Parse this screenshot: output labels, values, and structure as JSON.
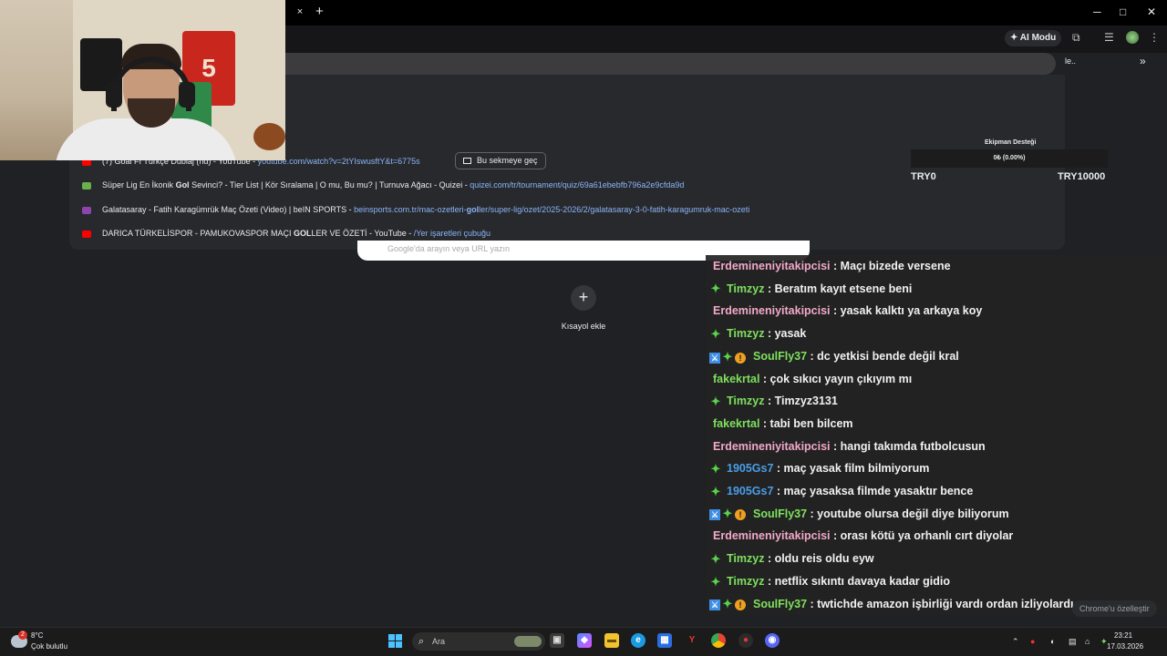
{
  "browser": {
    "tab_close": "×",
    "new_tab": "+",
    "win_min": "─",
    "win_max": "□",
    "win_close": "✕",
    "ai_mode_label": "AI Modu",
    "bookmark_text": "le..",
    "bookmark_more": "»"
  },
  "suggestions": [
    {
      "title": "(7) Goal Fı Türkçe Dublaj (hd) - YouTube",
      "sep": " - ",
      "url_pre": "youtube.com/watch?v=2tYIswusftY&t=6775s",
      "color": "#ff0000"
    },
    {
      "title_pre": "Süper Lig En İkonik ",
      "title_bold": "Gol",
      "title_post": " Sevinci? - Tier List | Kör Sıralama | O mu, Bu mu? | Turnuva Ağacı - Quizei",
      "sep": " - ",
      "url": "quizei.com/tr/tournament/quiz/69a61ebebfb796a2e9cfda9d",
      "color": "#6ab04c"
    },
    {
      "title": "Galatasaray - Fatih Karagümrük Maç Özeti (Video) | beIN SPORTS",
      "sep": " - ",
      "url_pre": "beinsports.com.tr/mac-ozetleri-",
      "url_bold": "gol",
      "url_post": "ler/super-lig/ozet/2025-2026/2/galatasaray-3-0-fatih-karagumruk-mac-ozeti",
      "color": "#8e44ad"
    },
    {
      "title_pre": "DARICA TÜRKELİSPOR - PAMUKOVASPOR MAÇI ",
      "title_bold": "GOL",
      "title_post": "LER VE ÖZETİ - YouTube",
      "sep": " - ",
      "url": "/Yer işaretleri çubuğu",
      "color": "#ff0000"
    }
  ],
  "switch_tab_label": "Bu sekmeye geç",
  "donation": {
    "title": "Ekipman Desteği",
    "progress_text": "0₺ (0.00%)",
    "progress_fraction": 0.0,
    "min_label": "TRY0",
    "max_label": "TRY10000"
  },
  "new_tab_page": {
    "search_placeholder": "Google'da arayın veya URL yazın",
    "add_shortcut_icon": "+",
    "add_shortcut_label": "Kısayol ekle",
    "customize_label": "Chrome'u özelleştir"
  },
  "chat": {
    "colors": {
      "green": "#7ee05f",
      "pink": "#f2a9c9",
      "blue": "#4a9de8"
    },
    "messages": [
      {
        "user": "Erdemineniyitakipcisi",
        "color": "pink",
        "badges": [],
        "text": ": Maçı bizede versene"
      },
      {
        "user": "Timzyz",
        "color": "green",
        "badges": [
          "star"
        ],
        "text": ": Beratım kayıt etsene beni"
      },
      {
        "user": "Erdemineniyitakipcisi",
        "color": "pink",
        "badges": [],
        "text": ": yasak kalktı ya arkaya koy"
      },
      {
        "user": "Timzyz",
        "color": "green",
        "badges": [
          "star"
        ],
        "text": ": yasak"
      },
      {
        "user": "SoulFly37",
        "color": "green",
        "badges": [
          "mod",
          "star",
          "warn"
        ],
        "text": ": dc yetkisi bende değil kral"
      },
      {
        "user": "fakekrtal",
        "color": "green",
        "badges": [],
        "text": ": çok sıkıcı yayın çıkıyım mı"
      },
      {
        "user": "Timzyz",
        "color": "green",
        "badges": [
          "star"
        ],
        "text": ": Timzyz3131"
      },
      {
        "user": "fakekrtal",
        "color": "green",
        "badges": [],
        "text": ": tabi ben bilcem"
      },
      {
        "user": "Erdemineniyitakipcisi",
        "color": "pink",
        "badges": [],
        "text": ": hangi takımda futbolcusun"
      },
      {
        "user": "1905Gs7",
        "color": "blue",
        "badges": [
          "star"
        ],
        "text": ": maç yasak film bilmiyorum"
      },
      {
        "user": "1905Gs7",
        "color": "blue",
        "badges": [
          "star"
        ],
        "text": ": maç yasaksa filmde yasaktır bence"
      },
      {
        "user": "SoulFly37",
        "color": "green",
        "badges": [
          "mod",
          "star",
          "warn"
        ],
        "text": ": youtube olursa değil diye biliyorum"
      },
      {
        "user": "Erdemineniyitakipcisi",
        "color": "pink",
        "badges": [],
        "text": ": orası kötü ya orhanlı cırt diyolar"
      },
      {
        "user": "Timzyz",
        "color": "green",
        "badges": [
          "star"
        ],
        "text": ": oldu reis oldu eyw"
      },
      {
        "user": "Timzyz",
        "color": "green",
        "badges": [
          "star"
        ],
        "text": ": netflix sıkıntı davaya kadar gidio"
      },
      {
        "user": "SoulFly37",
        "color": "green",
        "badges": [
          "mod",
          "star",
          "warn"
        ],
        "text": ": twtichde amazon işbirliği vardı ordan izliyolardı"
      }
    ]
  },
  "webcam": {
    "jersey_number": "5"
  },
  "taskbar": {
    "weather_temp": "8°C",
    "weather_condition": "Çok bulutlu",
    "weather_badge": "2",
    "search_label": "Ara",
    "time": "23:21",
    "date": "17.03.2026"
  }
}
